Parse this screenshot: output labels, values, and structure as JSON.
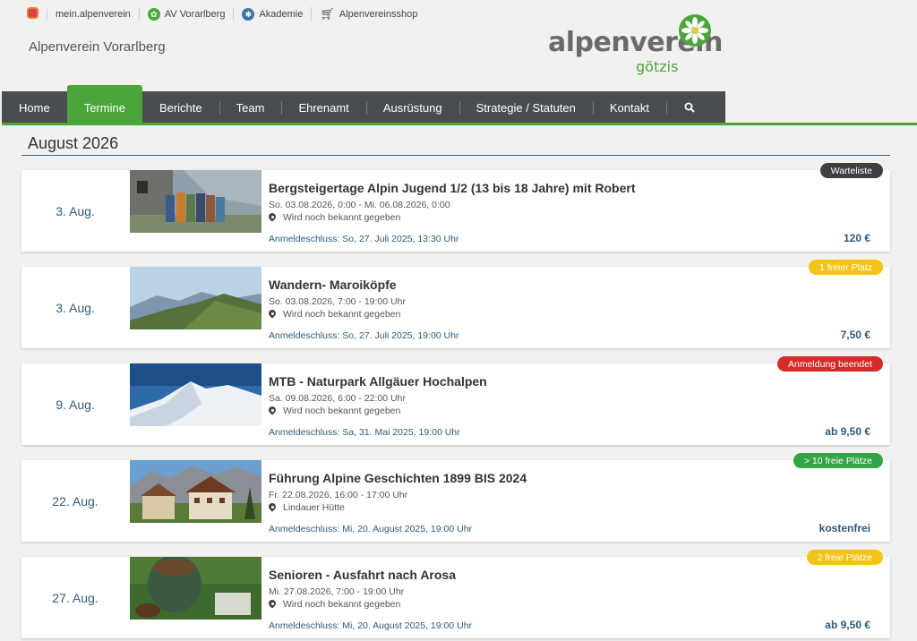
{
  "topbar": {
    "links": [
      "mein.alpenverein",
      "AV Vorarlberg",
      "Akademie",
      "Alpenvereinsshop"
    ]
  },
  "site": {
    "title": "Alpenverein Vorarlberg"
  },
  "logo": {
    "word": "alpenverein",
    "sub": "götzis"
  },
  "nav": {
    "items": [
      "Home",
      "Termine",
      "Berichte",
      "Team",
      "Ehrenamt",
      "Ausrüstung",
      "Strategie / Statuten",
      "Kontakt"
    ],
    "active": "Termine"
  },
  "month": "August 2026",
  "events": [
    {
      "date": "3. Aug.",
      "title": "Bergsteigertage Alpin Jugend 1/2 (13 bis 18 Jahre) mit Robert",
      "when": "So. 03.08.2026, 0:00 - Mi. 06.08.2026, 0:00",
      "where": "Wird noch bekannt gegeben",
      "deadline": "Anmeldeschluss: So, 27. Juli 2025, 13:30 Uhr",
      "price": "120 €",
      "badge": "Warteliste",
      "badge_color": "#3d3f42"
    },
    {
      "date": "3. Aug.",
      "title": "Wandern- Maroiköpfe",
      "when": "So. 03.08.2026, 7:00 - 19:00 Uhr",
      "where": "Wird noch bekannt gegeben",
      "deadline": "Anmeldeschluss: So, 27. Juli 2025, 19:00 Uhr",
      "price": "7,50 €",
      "badge": "1 freier Platz",
      "badge_color": "#f3c417"
    },
    {
      "date": "9. Aug.",
      "title": "MTB - Naturpark Allgäuer Hochalpen",
      "when": "Sa. 09.08.2026, 6:00 - 22:00 Uhr",
      "where": "Wird noch bekannt gegeben",
      "deadline": "Anmeldeschluss: Sa, 31. Mai 2025, 19:00 Uhr",
      "price": "ab 9,50 €",
      "badge": "Anmeldung beendet",
      "badge_color": "#d62b2b"
    },
    {
      "date": "22. Aug.",
      "title": "Führung Alpine Geschichten 1899 BIS 2024",
      "when": "Fr. 22.08.2026, 16:00 - 17:00 Uhr",
      "where": "Lindauer Hütte",
      "deadline": "Anmeldeschluss: Mi, 20. August 2025, 19:00 Uhr",
      "price": "kostenfrei",
      "badge": "> 10 freie Plätze",
      "badge_color": "#34a546"
    },
    {
      "date": "27. Aug.",
      "title": "Senioren - Ausfahrt nach Arosa",
      "when": "Mi. 27.08.2026, 7:00 - 19:00 Uhr",
      "where": "Wird noch bekannt gegeben",
      "deadline": "Anmeldeschluss: Mi, 20. August 2025, 19:00 Uhr",
      "price": "ab 9,50 €",
      "badge": "2 freie Plätze",
      "badge_color": "#f3c417"
    }
  ]
}
